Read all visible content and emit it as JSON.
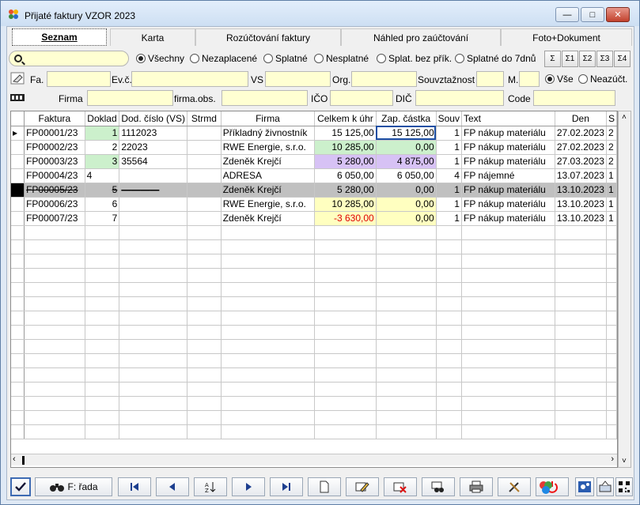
{
  "window": {
    "title": "Přijaté faktury VZOR  2023"
  },
  "tabs": [
    {
      "label": "Seznam",
      "active": true
    },
    {
      "label": "Karta"
    },
    {
      "label": "Rozúčtování faktury"
    },
    {
      "label": "Náhled pro zaúčtování"
    },
    {
      "label": "Foto+Dokument"
    }
  ],
  "filters": {
    "search": {
      "value": ""
    },
    "status": [
      "Všechny",
      "Nezaplacené",
      "Splatné",
      "Nesplatné",
      "Splat. bez přík.",
      "Splatné do 7dnů"
    ],
    "sums": [
      "Σ",
      "Σ1",
      "Σ2",
      "Σ3",
      "Σ4"
    ],
    "row1": {
      "fa": "Fa.",
      "evc": "Ev.č.",
      "vs": "VS",
      "org": "Org.",
      "souv": "Souvztažnost",
      "m": "M.",
      "r_all": "Vše",
      "r_unposted": "Neazúčt."
    },
    "row2": {
      "firma": "Firma",
      "firma_obs": "firma.obs.",
      "ico": "IČO",
      "dic": "DIČ",
      "code": "Code"
    }
  },
  "table": {
    "columns": [
      "Faktura",
      "Doklad",
      "Dod. číslo (VS)",
      "Strmd",
      "Firma",
      "Celkem k úhr",
      "Zap. částka",
      "Souv",
      "Text",
      "Den",
      "S"
    ],
    "rows": [
      [
        "FP00001/23",
        "1",
        "1112023",
        "",
        "Příkladný živnostník",
        "15 125,00",
        "15 125,00",
        "1",
        "FP nákup materiálu",
        "27.02.2023",
        "2"
      ],
      [
        "FP00002/23",
        "2",
        "22023",
        "",
        "RWE Energie, s.r.o.",
        "10 285,00",
        "0,00",
        "1",
        "FP nákup materiálu",
        "27.02.2023",
        "2"
      ],
      [
        "FP00003/23",
        "3",
        "35564",
        "",
        "Zdeněk Krejčí",
        "5 280,00",
        "4 875,00",
        "1",
        "FP nákup materiálu",
        "27.03.2023",
        "2"
      ],
      [
        "FP00004/23",
        "4",
        "",
        "",
        "ADRESA",
        "6 050,00",
        "6 050,00",
        "4",
        "FP nájemné",
        "13.07.2023",
        "1"
      ],
      [
        "FP00005/23",
        "5",
        "",
        "",
        "Zdeněk Krejčí",
        "5 280,00",
        "0,00",
        "1",
        "FP nákup materiálu",
        "13.10.2023",
        "1"
      ],
      [
        "FP00006/23",
        "6",
        "",
        "",
        "RWE Energie, s.r.o.",
        "10 285,00",
        "0,00",
        "1",
        "FP nákup materiálu",
        "13.10.2023",
        "1"
      ],
      [
        "FP00007/23",
        "7",
        "",
        "",
        "Zdeněk Krejčí",
        "-3 630,00",
        "0,00",
        "1",
        "FP nákup materiálu",
        "13.10.2023",
        "1"
      ]
    ]
  },
  "toolbar": {
    "series_label": "F: řada"
  },
  "colors": {
    "green": "#ccf0cc",
    "purple": "#d7c2f5",
    "yellow": "#ffffc0",
    "red": "#e00000"
  }
}
